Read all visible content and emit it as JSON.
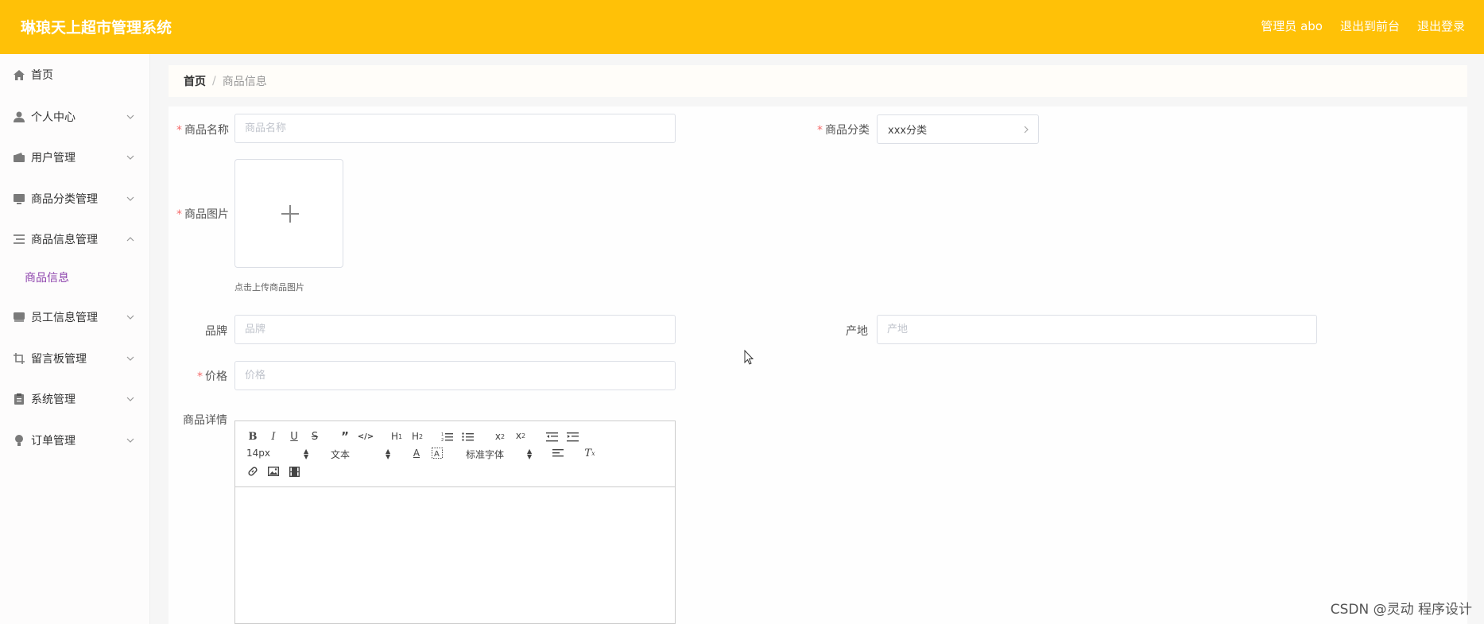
{
  "header": {
    "title": "琳琅天上超市管理系统",
    "admin": "管理员 abo",
    "to_frontend": "退出到前台",
    "logout": "退出登录",
    "bg_color": "#ffc107"
  },
  "sidebar": {
    "items": [
      {
        "label": "首页",
        "icon": "home-icon",
        "expandable": false
      },
      {
        "label": "个人中心",
        "icon": "user-icon",
        "expandable": true,
        "expanded": false
      },
      {
        "label": "用户管理",
        "icon": "wallet-icon",
        "expandable": true,
        "expanded": false
      },
      {
        "label": "商品分类管理",
        "icon": "monitor-icon",
        "expandable": true,
        "expanded": false
      },
      {
        "label": "商品信息管理",
        "icon": "list-icon",
        "expandable": true,
        "expanded": true
      },
      {
        "label": "员工信息管理",
        "icon": "folder-icon",
        "expandable": true,
        "expanded": false
      },
      {
        "label": "留言板管理",
        "icon": "crop-icon",
        "expandable": true,
        "expanded": false
      },
      {
        "label": "系统管理",
        "icon": "clipboard-icon",
        "expandable": true,
        "expanded": false
      },
      {
        "label": "订单管理",
        "icon": "bulb-icon",
        "expandable": true,
        "expanded": false
      }
    ],
    "sub_item": {
      "label": "商品信息",
      "color": "#8e44ad"
    }
  },
  "breadcrumb": {
    "home": "首页",
    "separator": "/",
    "current": "商品信息"
  },
  "form": {
    "name": {
      "label": "商品名称",
      "placeholder": "商品名称",
      "required": true
    },
    "category": {
      "label": "商品分类",
      "value": "xxx分类",
      "required": true
    },
    "image": {
      "label": "商品图片",
      "tip": "点击上传商品图片",
      "required": true
    },
    "brand": {
      "label": "品牌",
      "placeholder": "品牌",
      "required": false
    },
    "origin": {
      "label": "产地",
      "placeholder": "产地",
      "required": false
    },
    "price": {
      "label": "价格",
      "placeholder": "价格",
      "required": true
    },
    "detail": {
      "label": "商品详情",
      "required": false
    }
  },
  "editor": {
    "font_size": "14px",
    "header_select": "文本",
    "font_family": "标准字体",
    "buttons": [
      "bold-icon",
      "italic-icon",
      "underline-icon",
      "strike-icon",
      "blockquote-icon",
      "code-block-icon",
      "h1-icon",
      "h2-icon",
      "ordered-list-icon",
      "bullet-list-icon",
      "subscript-icon",
      "superscript-icon",
      "outdent-icon",
      "indent-icon",
      "font-color-icon",
      "background-color-icon",
      "align-icon",
      "clean-format-icon",
      "link-icon",
      "image-icon",
      "video-icon"
    ]
  },
  "watermark": "CSDN @灵动 程序设计"
}
